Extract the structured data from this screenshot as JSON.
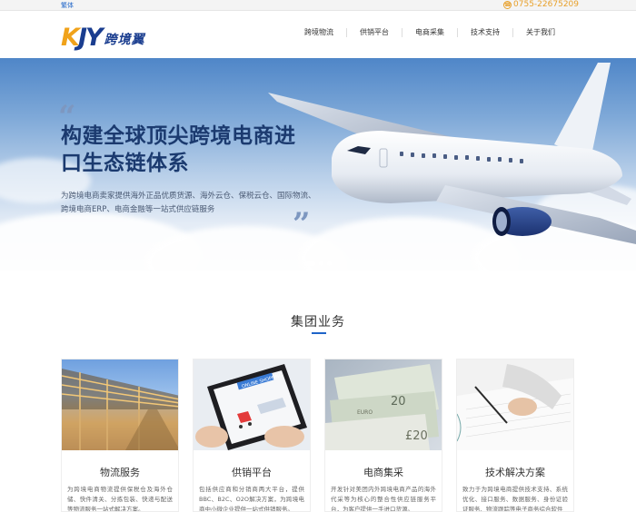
{
  "topbar": {
    "lang": "繁体",
    "phone": "0755-22675209",
    "phone_icon": "phone-icon"
  },
  "logo": {
    "letter_k": "K",
    "letters_jy": "JY",
    "cn": "跨境翼"
  },
  "nav": [
    "跨境物流",
    "供销平台",
    "电商采集",
    "技术支持",
    "关于我们"
  ],
  "banner": {
    "quote_open": "“",
    "quote_close": "”",
    "title": "构建全球顶尖跨境电商进口生态链体系",
    "desc": "为跨境电商卖家提供海外正品优质货源、海外云仓、保税云仓、国际物流、跨境电商ERP、电商金融等一站式供应链服务",
    "slides": 3,
    "active_slide": 1
  },
  "section": {
    "title": "集团业务"
  },
  "cards": [
    {
      "name": "物流服务",
      "desc": "为跨境电商物流提供保税仓及海外仓储、快件清关、分拣包装、快递与配送等物流服务一站式解决方案。"
    },
    {
      "name": "供销平台",
      "desc": "包括供应商和分销商两大平台，提供BBC、B2C、O2O解决方案，为跨境电商中小微企业提供一站式供销服务。"
    },
    {
      "name": "电商集采",
      "desc": "开发针对美团内外跨境电商产品的海外代采等为核心的整合性供应链服务平台，为客户提供一手进口货源。"
    },
    {
      "name": "技术解决方案",
      "desc": "致力于为跨境电商提供技术支持、系统优化、接口服务、数据服务、身份证验证服务、物流跟踪等电子商务综合软件"
    }
  ],
  "colors": {
    "accent": "#1e64c8",
    "brand_orange": "#f0a21a",
    "brand_blue": "#1a3d8f",
    "phone": "#e8a02a"
  }
}
